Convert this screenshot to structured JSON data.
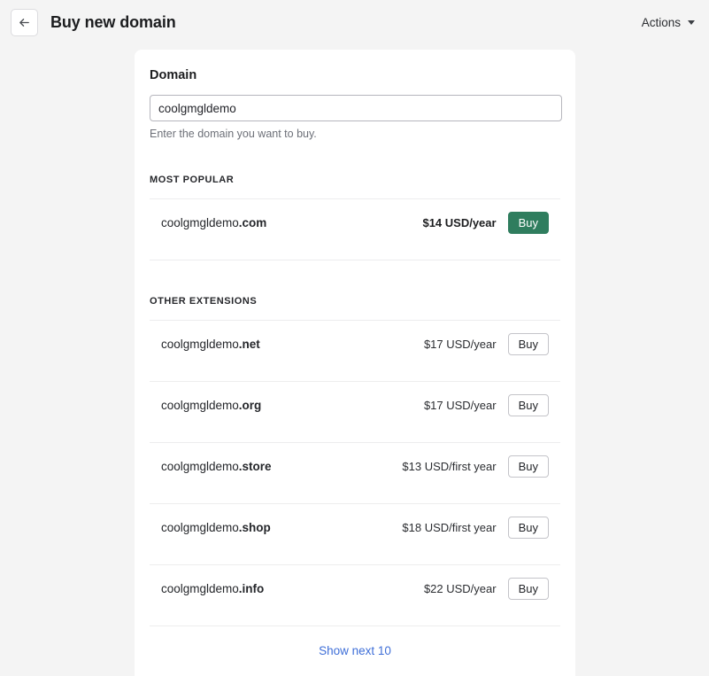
{
  "header": {
    "title": "Buy new domain",
    "back_icon": "arrow-left-icon",
    "actions_label": "Actions",
    "actions_caret_icon": "chevron-down-icon"
  },
  "form": {
    "label": "Domain",
    "value": "coolgmgldemo",
    "placeholder": "",
    "helper": "Enter the domain you want to buy."
  },
  "most_popular": {
    "heading": "Most popular",
    "rows": [
      {
        "name": "coolgmgldemo",
        "tld": ".com",
        "price": "$14 USD/year",
        "buy_label": "Buy"
      }
    ]
  },
  "other_extensions": {
    "heading": "Other extensions",
    "rows": [
      {
        "name": "coolgmgldemo",
        "tld": ".net",
        "price": "$17 USD/year",
        "buy_label": "Buy"
      },
      {
        "name": "coolgmgldemo",
        "tld": ".org",
        "price": "$17 USD/year",
        "buy_label": "Buy"
      },
      {
        "name": "coolgmgldemo",
        "tld": ".store",
        "price": "$13 USD/first year",
        "buy_label": "Buy"
      },
      {
        "name": "coolgmgldemo",
        "tld": ".shop",
        "price": "$18 USD/first year",
        "buy_label": "Buy"
      },
      {
        "name": "coolgmgldemo",
        "tld": ".info",
        "price": "$22 USD/year",
        "buy_label": "Buy"
      }
    ]
  },
  "footer": {
    "show_more_label": "Show next 10"
  },
  "colors": {
    "page_background": "#f4f4f4",
    "card_background": "#ffffff",
    "primary_button": "#2f7d5e",
    "link": "#3f6fd8",
    "border": "#c4c4c9",
    "divider": "#ededee",
    "muted_text": "#6d7078"
  }
}
